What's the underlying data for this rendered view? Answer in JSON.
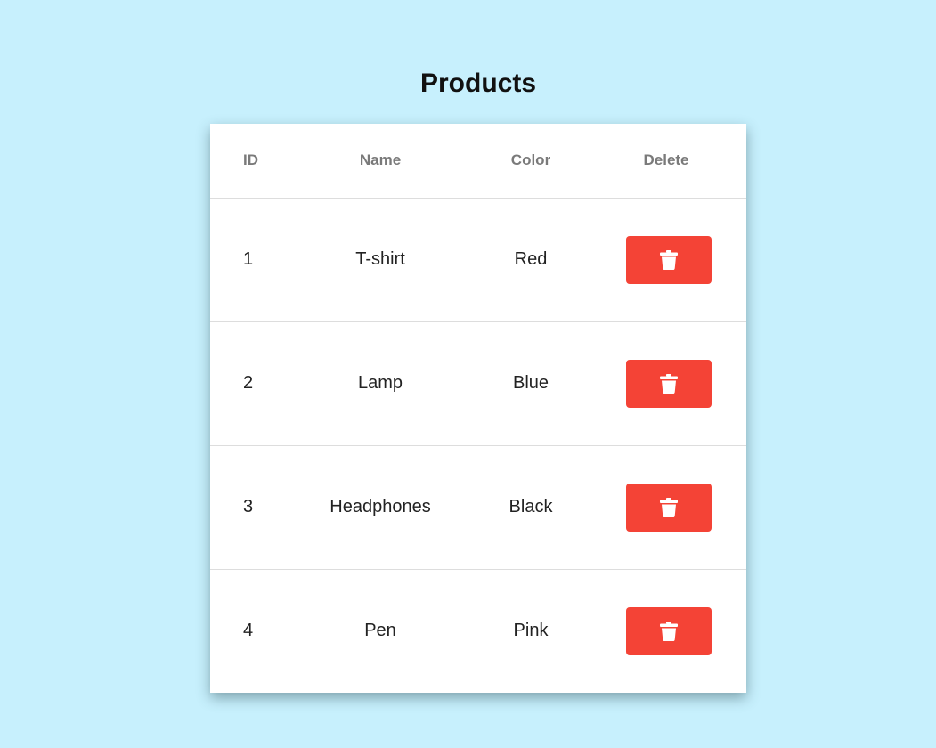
{
  "page": {
    "title": "Products"
  },
  "table": {
    "headers": {
      "id": "ID",
      "name": "Name",
      "color": "Color",
      "delete": "Delete"
    },
    "rows": [
      {
        "id": "1",
        "name": "T-shirt",
        "color": "Red"
      },
      {
        "id": "2",
        "name": "Lamp",
        "color": "Blue"
      },
      {
        "id": "3",
        "name": "Headphones",
        "color": "Black"
      },
      {
        "id": "4",
        "name": "Pen",
        "color": "Pink"
      }
    ],
    "delete_icon": "trash-icon"
  },
  "colors": {
    "background": "#c7f0fd",
    "delete_button": "#f44336",
    "header_text": "#7a7a7a"
  }
}
